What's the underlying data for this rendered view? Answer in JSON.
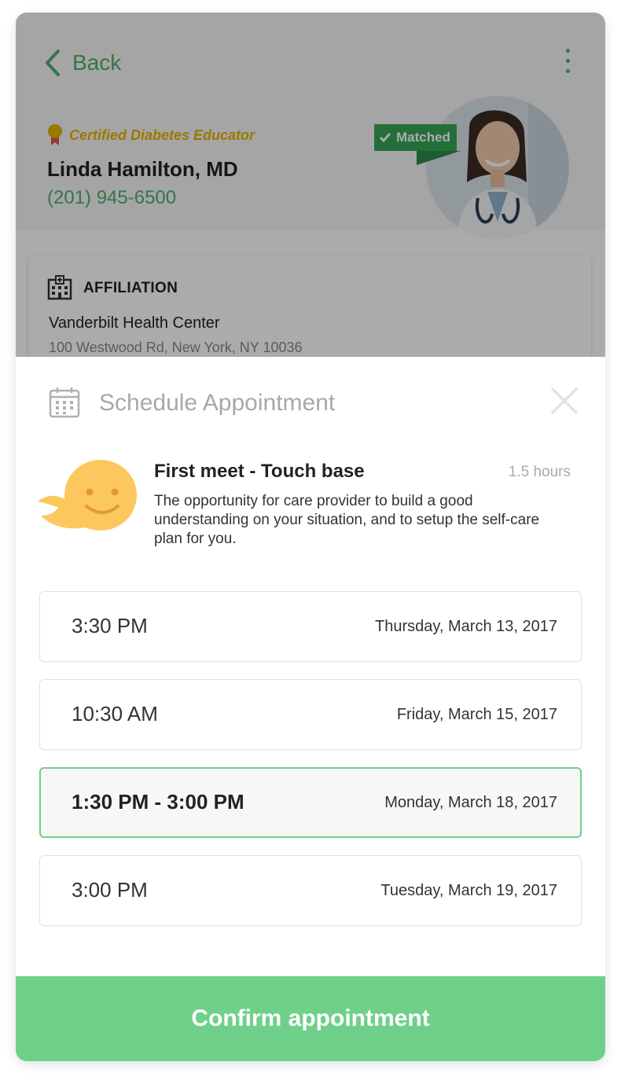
{
  "profile": {
    "back_label": "Back",
    "certification": "Certified Diabetes Educator",
    "name": "Linda Hamilton, MD",
    "phone": "(201) 945-6500",
    "matched_label": "Matched",
    "affiliation": {
      "heading": "AFFILIATION",
      "name": "Vanderbilt Health Center",
      "address": "100 Westwood Rd, New York, NY 10036"
    }
  },
  "sheet": {
    "title": "Schedule Appointment",
    "meeting": {
      "title": "First meet - Touch base",
      "duration": "1.5 hours",
      "description": "The opportunity for care provider to build a good understanding on your situation, and to setup the self-care plan for you."
    },
    "slots": [
      {
        "time": "3:30 PM",
        "date": "Thursday, March 13, 2017",
        "selected": false
      },
      {
        "time": "10:30 AM",
        "date": "Friday, March 15, 2017",
        "selected": false
      },
      {
        "time": "1:30 PM - 3:00 PM",
        "date": "Monday, March 18, 2017",
        "selected": true
      },
      {
        "time": "3:00 PM",
        "date": "Tuesday, March 19, 2017",
        "selected": false
      }
    ],
    "confirm_label": "Confirm appointment"
  },
  "colors": {
    "accent": "#6fd089",
    "link": "#4caf6c",
    "badge": "#e7b400",
    "matched": "#36a457",
    "mascot": "#fcc85d"
  },
  "icons": [
    "chevron-left-icon",
    "more-vertical-icon",
    "award-icon",
    "check-icon",
    "hospital-icon",
    "calendar-icon",
    "close-icon",
    "smiley-mascot"
  ]
}
